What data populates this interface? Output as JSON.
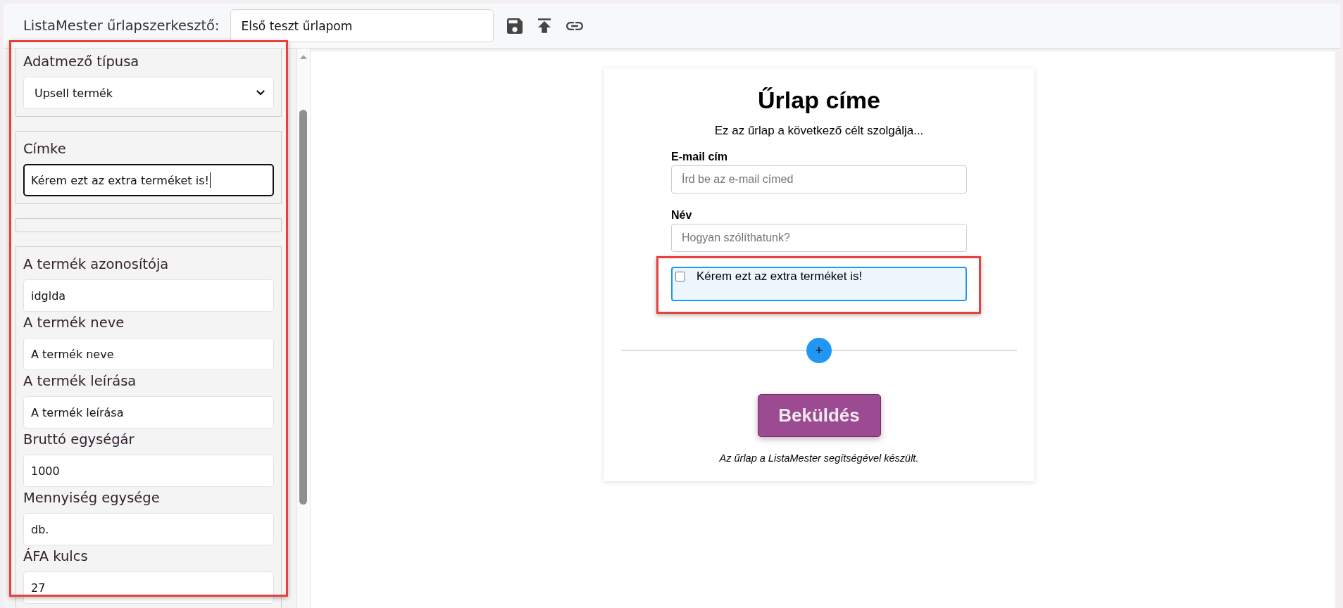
{
  "toolbar": {
    "title": "ListaMester űrlapszerkesztő:",
    "form_name": "Első teszt űrlapom"
  },
  "sidebar": {
    "highlighted": true,
    "panels": [
      {
        "kind": "group",
        "fields": [
          {
            "kind": "select",
            "label": "Adatmező típusa",
            "value": "Upsell termék",
            "focused": false
          }
        ]
      },
      {
        "kind": "group",
        "fields": [
          {
            "kind": "text",
            "label": "Címke",
            "value": "Kérem ezt az extra terméket is!",
            "focused": true
          }
        ]
      },
      {
        "kind": "empty"
      },
      {
        "kind": "group",
        "fields": [
          {
            "kind": "text",
            "label": "A termék azonosítója",
            "value": "idglda",
            "focused": false
          },
          {
            "kind": "text",
            "label": "A termék neve",
            "value": "A termék neve",
            "focused": false
          },
          {
            "kind": "text",
            "label": "A termék leírása",
            "value": "A termék leírása",
            "focused": false
          },
          {
            "kind": "text",
            "label": "Bruttó egységár",
            "value": "1000",
            "focused": false
          },
          {
            "kind": "text",
            "label": "Mennyiség egysége",
            "value": "db.",
            "focused": false
          },
          {
            "kind": "text",
            "label": "ÁFA kulcs",
            "value": "27",
            "focused": false
          }
        ]
      }
    ]
  },
  "form_preview": {
    "title": "Űrlap címe",
    "subtitle": "Ez az űrlap a következő célt szolgálja...",
    "fields": [
      {
        "kind": "text",
        "label": "E-mail cím",
        "placeholder": "Írd be az e-mail címed",
        "selected": false,
        "highlighted": false
      },
      {
        "kind": "text",
        "label": "Név",
        "placeholder": "Hogyan szólíthatunk?",
        "selected": false,
        "highlighted": false
      },
      {
        "kind": "checkbox",
        "label": "Kérem ezt az extra terméket is!",
        "checked": false,
        "selected": true,
        "highlighted": true
      }
    ],
    "add_button": "+",
    "submit": "Beküldés",
    "footer": "Az űrlap a ListaMester segítségével készült."
  }
}
